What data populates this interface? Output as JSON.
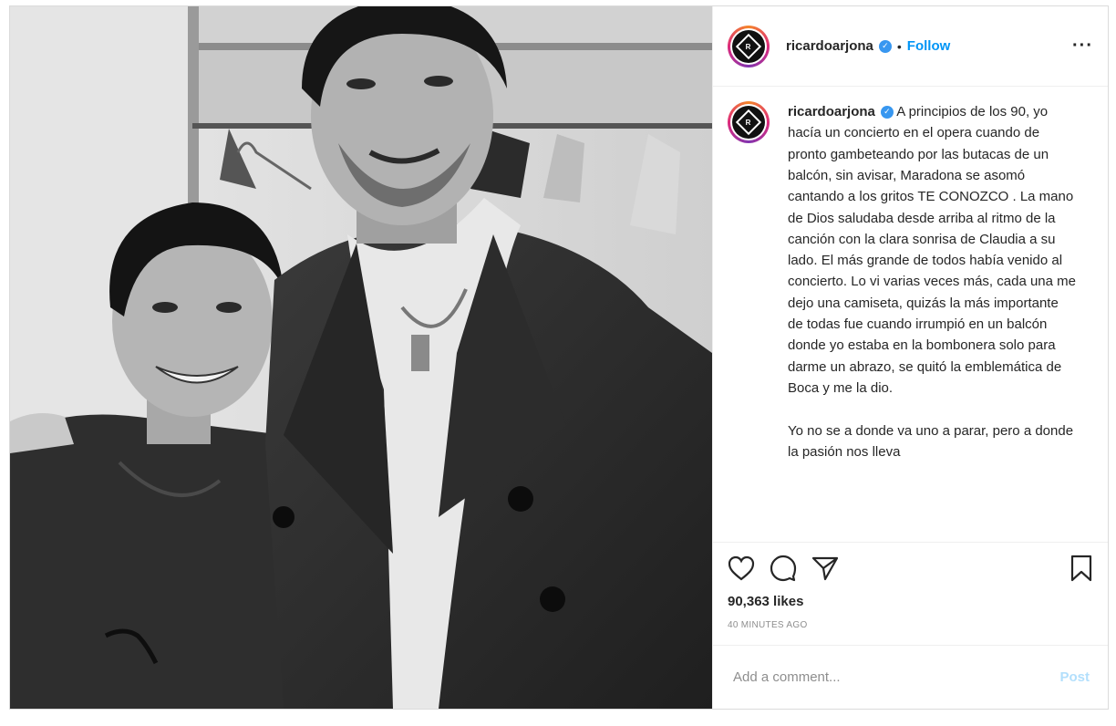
{
  "post": {
    "username": "ricardoarjona",
    "verified_glyph": "✓",
    "separator": "•",
    "follow_label": "Follow",
    "more_glyph": "···",
    "avatar_letters": "R",
    "caption_username": "ricardoarjona",
    "caption_text": "A principios de los 90, yo hacía un concierto en el opera cuando de pronto gambeteando por las butacas de un balcón, sin avisar, Maradona se asomó cantando a los gritos TE CONOZCO . La mano de Dios saludaba desde arriba al ritmo de la canción con la clara sonrisa de Claudia a su lado. El más grande de todos había venido al concierto. Lo vi varias veces más, cada una me dejo una camiseta, quizás la más importante de todas fue cuando irrumpió en un balcón donde yo estaba en la bombonera solo para darme un abrazo, se quitó la emblemática de Boca y me la dio.",
    "caption_text_2": "Yo no se a donde va uno a parar, pero a donde la pasión nos lleva",
    "likes": "90,363 likes",
    "time_ago": "40 MINUTES AGO",
    "comment_placeholder": "Add a comment...",
    "post_label": "Post"
  },
  "icons": {
    "like": "heart-icon",
    "comment": "comment-icon",
    "share": "share-icon",
    "save": "bookmark-icon"
  },
  "colors": {
    "follow": "#0095f6",
    "post_disabled": "#b2dffc",
    "verified": "#3897f0",
    "muted": "#8e8e8e"
  }
}
